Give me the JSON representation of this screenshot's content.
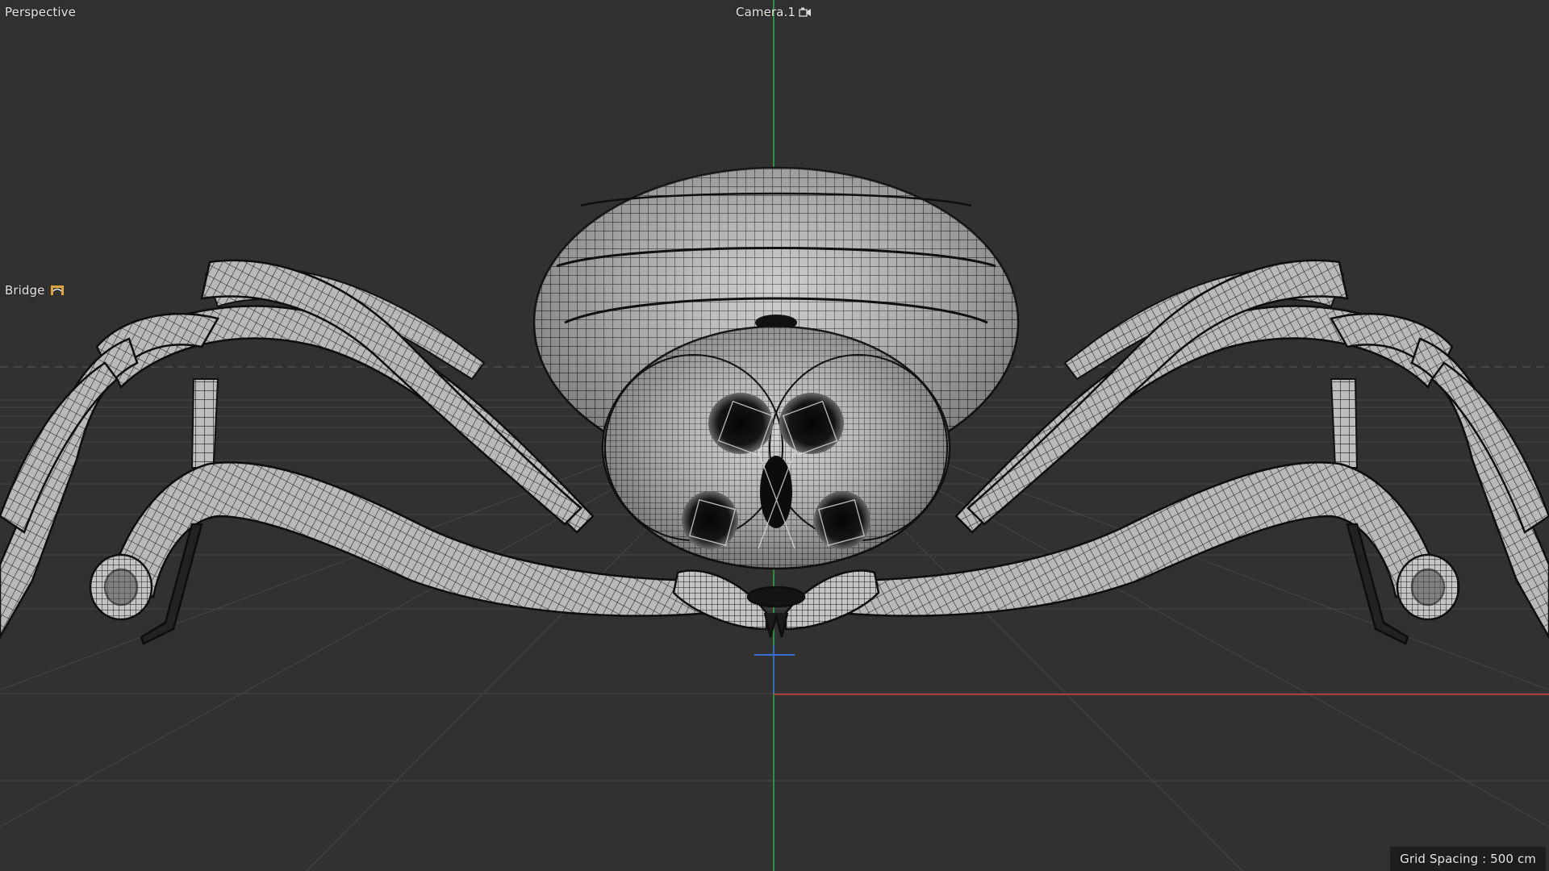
{
  "viewport": {
    "view_name": "Perspective",
    "camera_name": "Camera.1",
    "camera_icon": "camera-icon",
    "bridge_label": "Bridge",
    "bridge_icon": "bridge-icon",
    "grid_spacing": "Grid Spacing : 500 cm"
  },
  "colors": {
    "background": "#313131",
    "y_axis": "#2fbf4a",
    "x_axis": "#d23c3c",
    "z_axis": "#3a6fd8",
    "mesh_fill": "#b7b7b7",
    "wire": "#1a1a1a",
    "bridge_icon_color": "#e0a23a"
  },
  "scene": {
    "object": "spider wireframe mesh"
  }
}
